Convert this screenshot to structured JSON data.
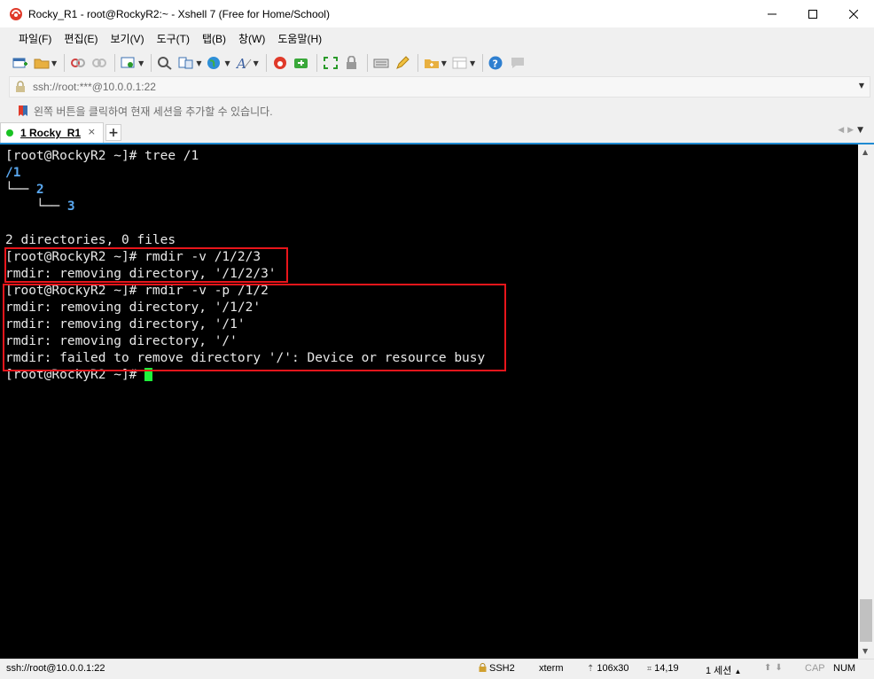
{
  "window": {
    "title": "Rocky_R1 - root@RockyR2:~ - Xshell 7 (Free for Home/School)",
    "controls": [
      "minimize-icon",
      "maximize-icon",
      "close-icon"
    ]
  },
  "menu": {
    "items": [
      "파일(F)",
      "편집(E)",
      "보기(V)",
      "도구(T)",
      "탭(B)",
      "창(W)",
      "도움말(H)"
    ]
  },
  "toolbar": {
    "icons": [
      "new-session-icon",
      "open-folder-icon",
      "disconnect-icon",
      "reconnect-icon",
      "properties-icon",
      "find-icon",
      "transfer-icon",
      "globe-icon",
      "font-icon",
      "xshell-logo-icon",
      "xftp-icon",
      "fullscreen-icon",
      "lock-icon",
      "keyboard-icon",
      "highlight-icon",
      "new-tab-icon",
      "layout-icon",
      "help-icon",
      "chat-icon"
    ]
  },
  "address": {
    "value": "ssh://root:***@10.0.0.1:22"
  },
  "info": {
    "text": "왼쪽 버튼을 클릭하여 현재 세션을 추가할 수 있습니다."
  },
  "tabs": [
    {
      "label": "1 Rocky_R1",
      "close": "×"
    }
  ],
  "terminal": {
    "lines": [
      "[root@RockyR2 ~]# tree /1",
      "/1",
      "└── 2",
      "    └── 3",
      "",
      "2 directories, 0 files",
      "[root@RockyR2 ~]# rmdir -v /1/2/3",
      "rmdir: removing directory, '/1/2/3'",
      "[root@RockyR2 ~]# rmdir -v -p /1/2",
      "rmdir: removing directory, '/1/2'",
      "rmdir: removing directory, '/1'",
      "rmdir: removing directory, '/'",
      "rmdir: failed to remove directory '/': Device or resource busy",
      "[root@RockyR2 ~]# "
    ],
    "tree_parts": {
      "root": "/1",
      "branch1": "└── ",
      "dir1": "2",
      "branch2": "    └── ",
      "dir2": "3"
    },
    "colors": {
      "background": "#000000",
      "text": "#e8e8e8",
      "directory": "#5aa8f0",
      "cursor": "#1ff23b",
      "highlight_box": "#e8151b"
    }
  },
  "status": {
    "connection": "ssh://root@10.0.0.1:22",
    "protocol": "SSH2",
    "terminal_type": "xterm",
    "size": "106x30",
    "cursor_pos": "14,19",
    "sessions": "1 세션",
    "caps": "CAP",
    "num": "NUM"
  }
}
